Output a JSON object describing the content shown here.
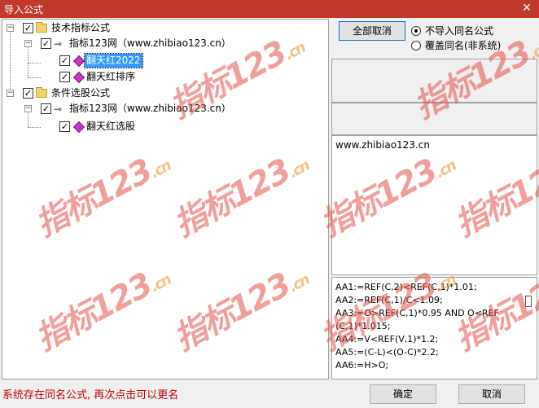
{
  "window": {
    "title": "导入公式",
    "close_label": "✕"
  },
  "tree": {
    "nodes": [
      {
        "label": "技术指标公式",
        "checked": true,
        "type": "folder",
        "expander": "−"
      },
      {
        "label": "指标123网（www.zhibiao123.cn）",
        "checked": true,
        "type": "key",
        "expander": "−"
      },
      {
        "label": "翻天红2022",
        "checked": true,
        "type": "formula",
        "selected": true
      },
      {
        "label": "翻天红排序",
        "checked": true,
        "type": "formula"
      },
      {
        "label": "条件选股公式",
        "checked": true,
        "type": "folder",
        "expander": "−"
      },
      {
        "label": "指标123网（www.zhibiao123.cn）",
        "checked": true,
        "type": "key",
        "expander": "−"
      },
      {
        "label": "翻天红选股",
        "checked": true,
        "type": "formula"
      }
    ]
  },
  "options": {
    "toggle_all_label": "全部取消",
    "radio_no_import": "不导入同名公式",
    "radio_overwrite": "覆盖同名(非系统)",
    "selected_radio": "no_import"
  },
  "info": {
    "description": "www.zhibiao123.cn"
  },
  "formula_lines": [
    "AA1:=REF(C,2)<REF(C,1)*1.01;",
    "AA2:=REF(C,1)/C<1.09;",
    "AA3:=O>REF(C,1)*0.95 AND O<REF",
    "(C,1)*1.015;",
    "AA4:=V<REF(V,1)*1.2;",
    "AA5:=(C-L)<(O-C)*2.2;",
    "AA6:=H>O;"
  ],
  "status_message": "系统存在同名公式, 再次点击可以更名",
  "footer": {
    "ok_label": "确定",
    "cancel_label": "取消"
  },
  "watermark": {
    "text": "指标123",
    "suffix": ".cn"
  },
  "colors": {
    "titlebar": "#c0392b",
    "selection": "#3399ff",
    "status_text": "#c00000",
    "watermark": "#e8524a"
  }
}
